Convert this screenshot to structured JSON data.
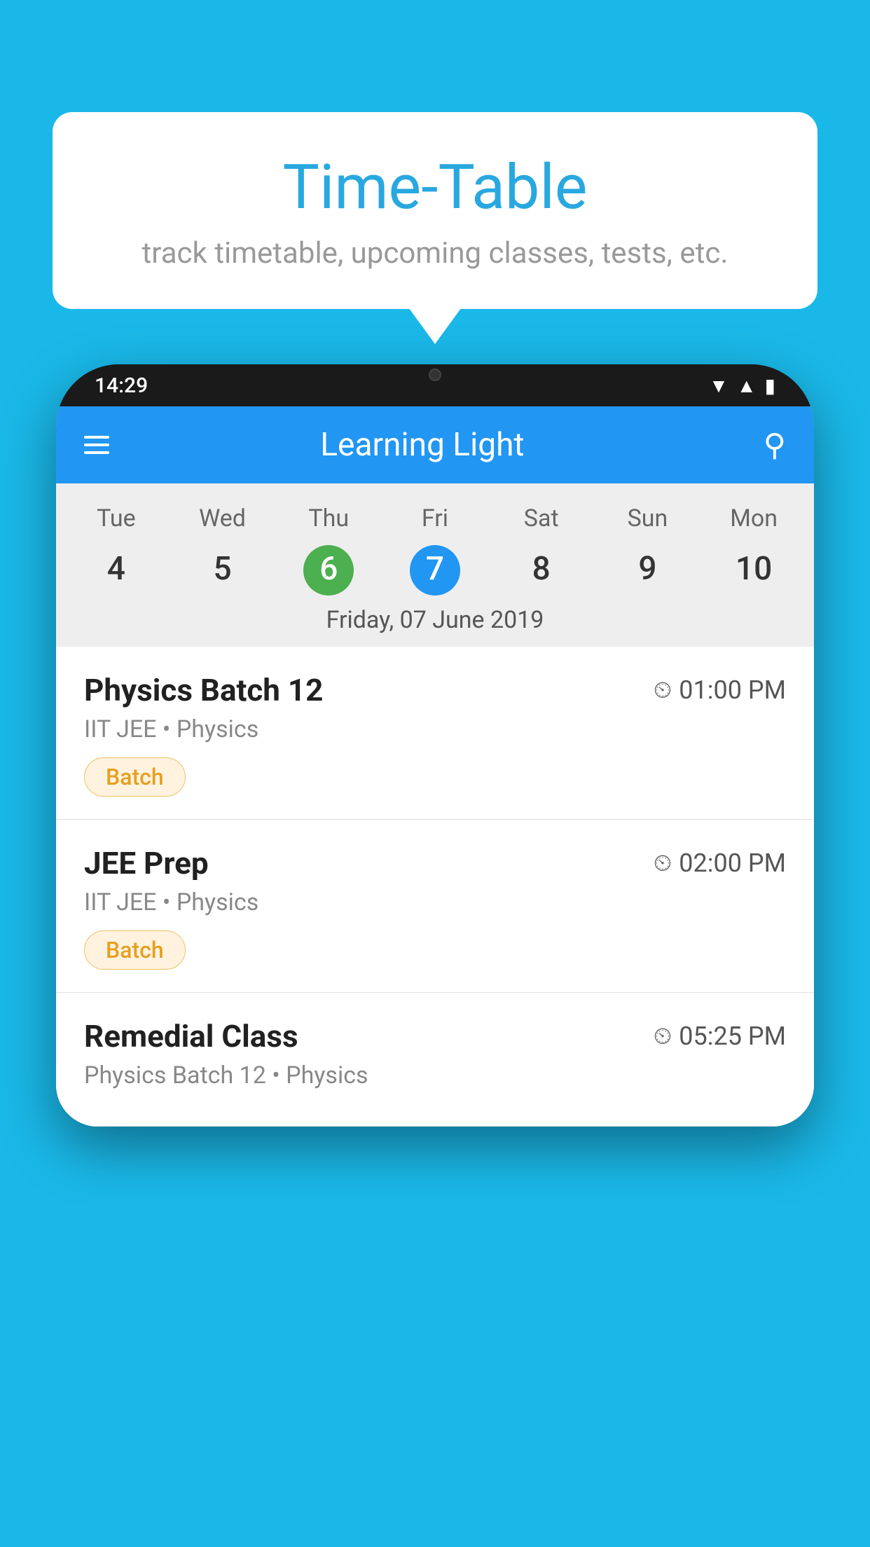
{
  "background_color": "#1ab8e8",
  "bubble": {
    "title": "Time-Table",
    "subtitle": "track timetable, upcoming classes, tests, etc."
  },
  "app_bar": {
    "time": "14:29",
    "title": "Learning Light",
    "menu_label": "menu",
    "search_label": "search"
  },
  "calendar": {
    "days_of_week": [
      "Tue",
      "Wed",
      "Thu",
      "Fri",
      "Sat",
      "Sun",
      "Mon"
    ],
    "dates": [
      "4",
      "5",
      "6",
      "7",
      "8",
      "9",
      "10"
    ],
    "today_index": 2,
    "selected_index": 3,
    "selected_date_label": "Friday, 07 June 2019"
  },
  "classes": [
    {
      "name": "Physics Batch 12",
      "time": "01:00 PM",
      "meta": "IIT JEE • Physics",
      "tag": "Batch"
    },
    {
      "name": "JEE Prep",
      "time": "02:00 PM",
      "meta": "IIT JEE • Physics",
      "tag": "Batch"
    },
    {
      "name": "Remedial Class",
      "time": "05:25 PM",
      "meta": "Physics Batch 12 • Physics",
      "tag": null
    }
  ]
}
